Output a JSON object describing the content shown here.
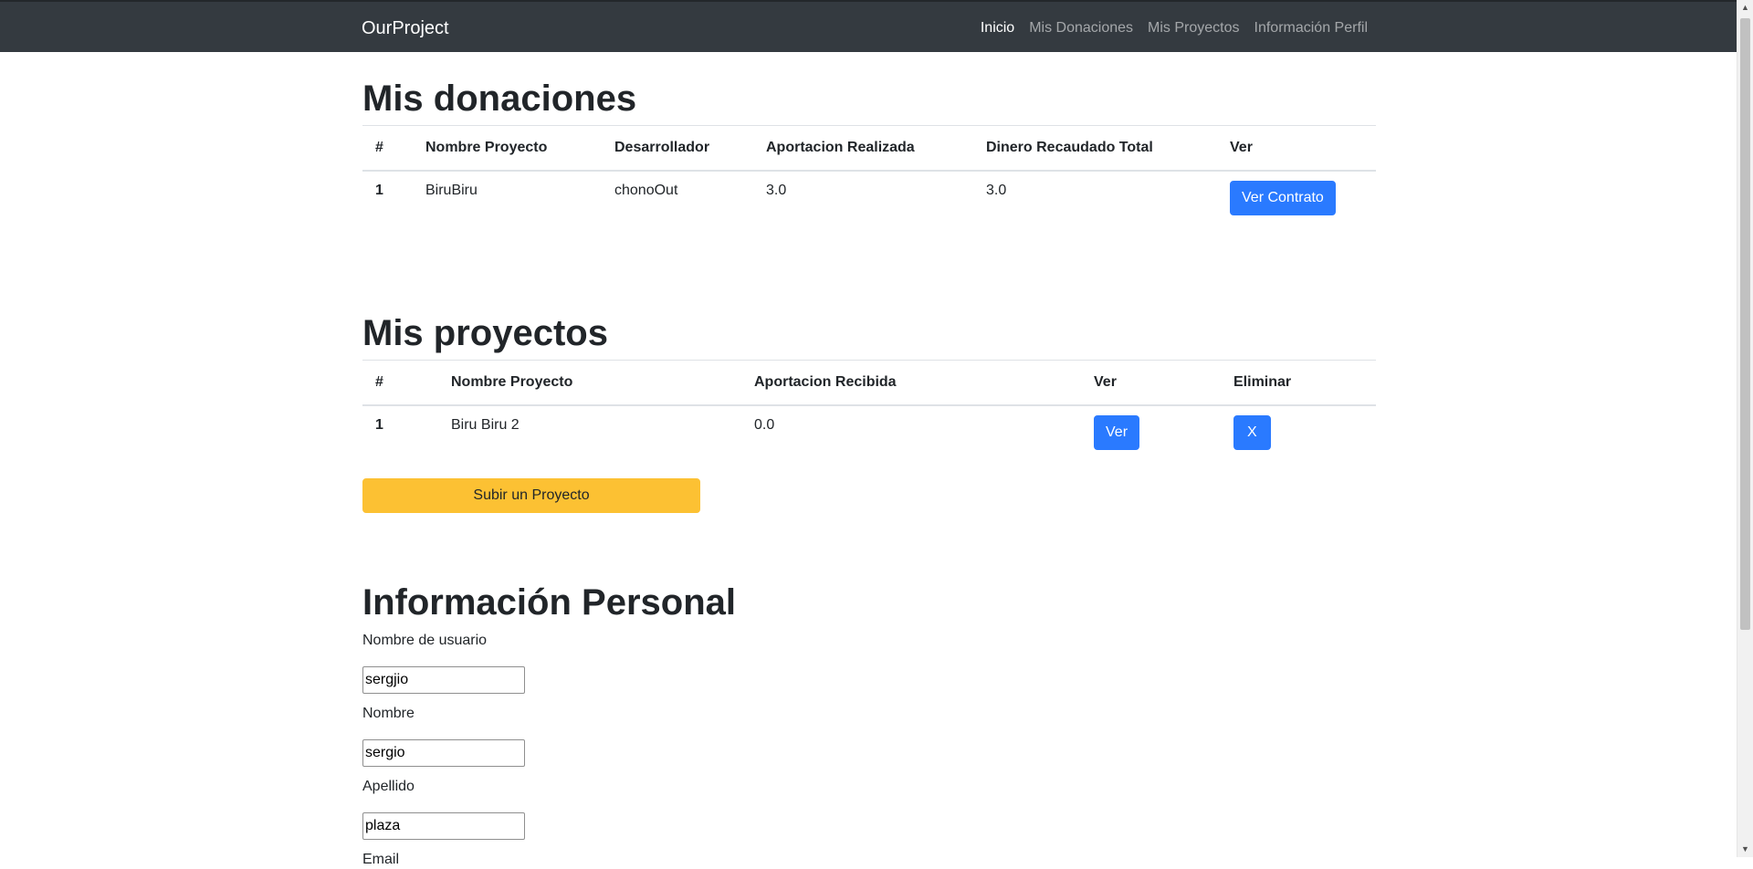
{
  "navbar": {
    "brand": "OurProject",
    "links": [
      "Inicio",
      "Mis Donaciones",
      "Mis Proyectos",
      "Información Perfil"
    ]
  },
  "donations": {
    "title": "Mis donaciones",
    "headers": [
      "#",
      "Nombre Proyecto",
      "Desarrollador",
      "Aportacion Realizada",
      "Dinero Recaudado Total",
      "Ver"
    ],
    "rows": [
      {
        "num": "1",
        "project": "BiruBiru",
        "developer": "chonoOut",
        "contribution": "3.0",
        "total": "3.0",
        "button": "Ver Contrato"
      }
    ]
  },
  "projects": {
    "title": "Mis proyectos",
    "headers": [
      "#",
      "Nombre Proyecto",
      "Aportacion Recibida",
      "Ver",
      "Eliminar"
    ],
    "rows": [
      {
        "num": "1",
        "project": "Biru Biru 2",
        "received": "0.0",
        "view_button": "Ver",
        "delete_button": "X"
      }
    ],
    "upload_button": "Subir un Proyecto"
  },
  "personal": {
    "title": "Información Personal",
    "fields": [
      {
        "label": "Nombre de usuario",
        "value": "sergjio"
      },
      {
        "label": "Nombre",
        "value": "sergio"
      },
      {
        "label": "Apellido",
        "value": "plaza"
      },
      {
        "label": "Email",
        "value": ""
      }
    ]
  },
  "colors": {
    "navbar_bg": "#343a40",
    "primary": "#2a7aff",
    "warning": "#fcc133"
  }
}
